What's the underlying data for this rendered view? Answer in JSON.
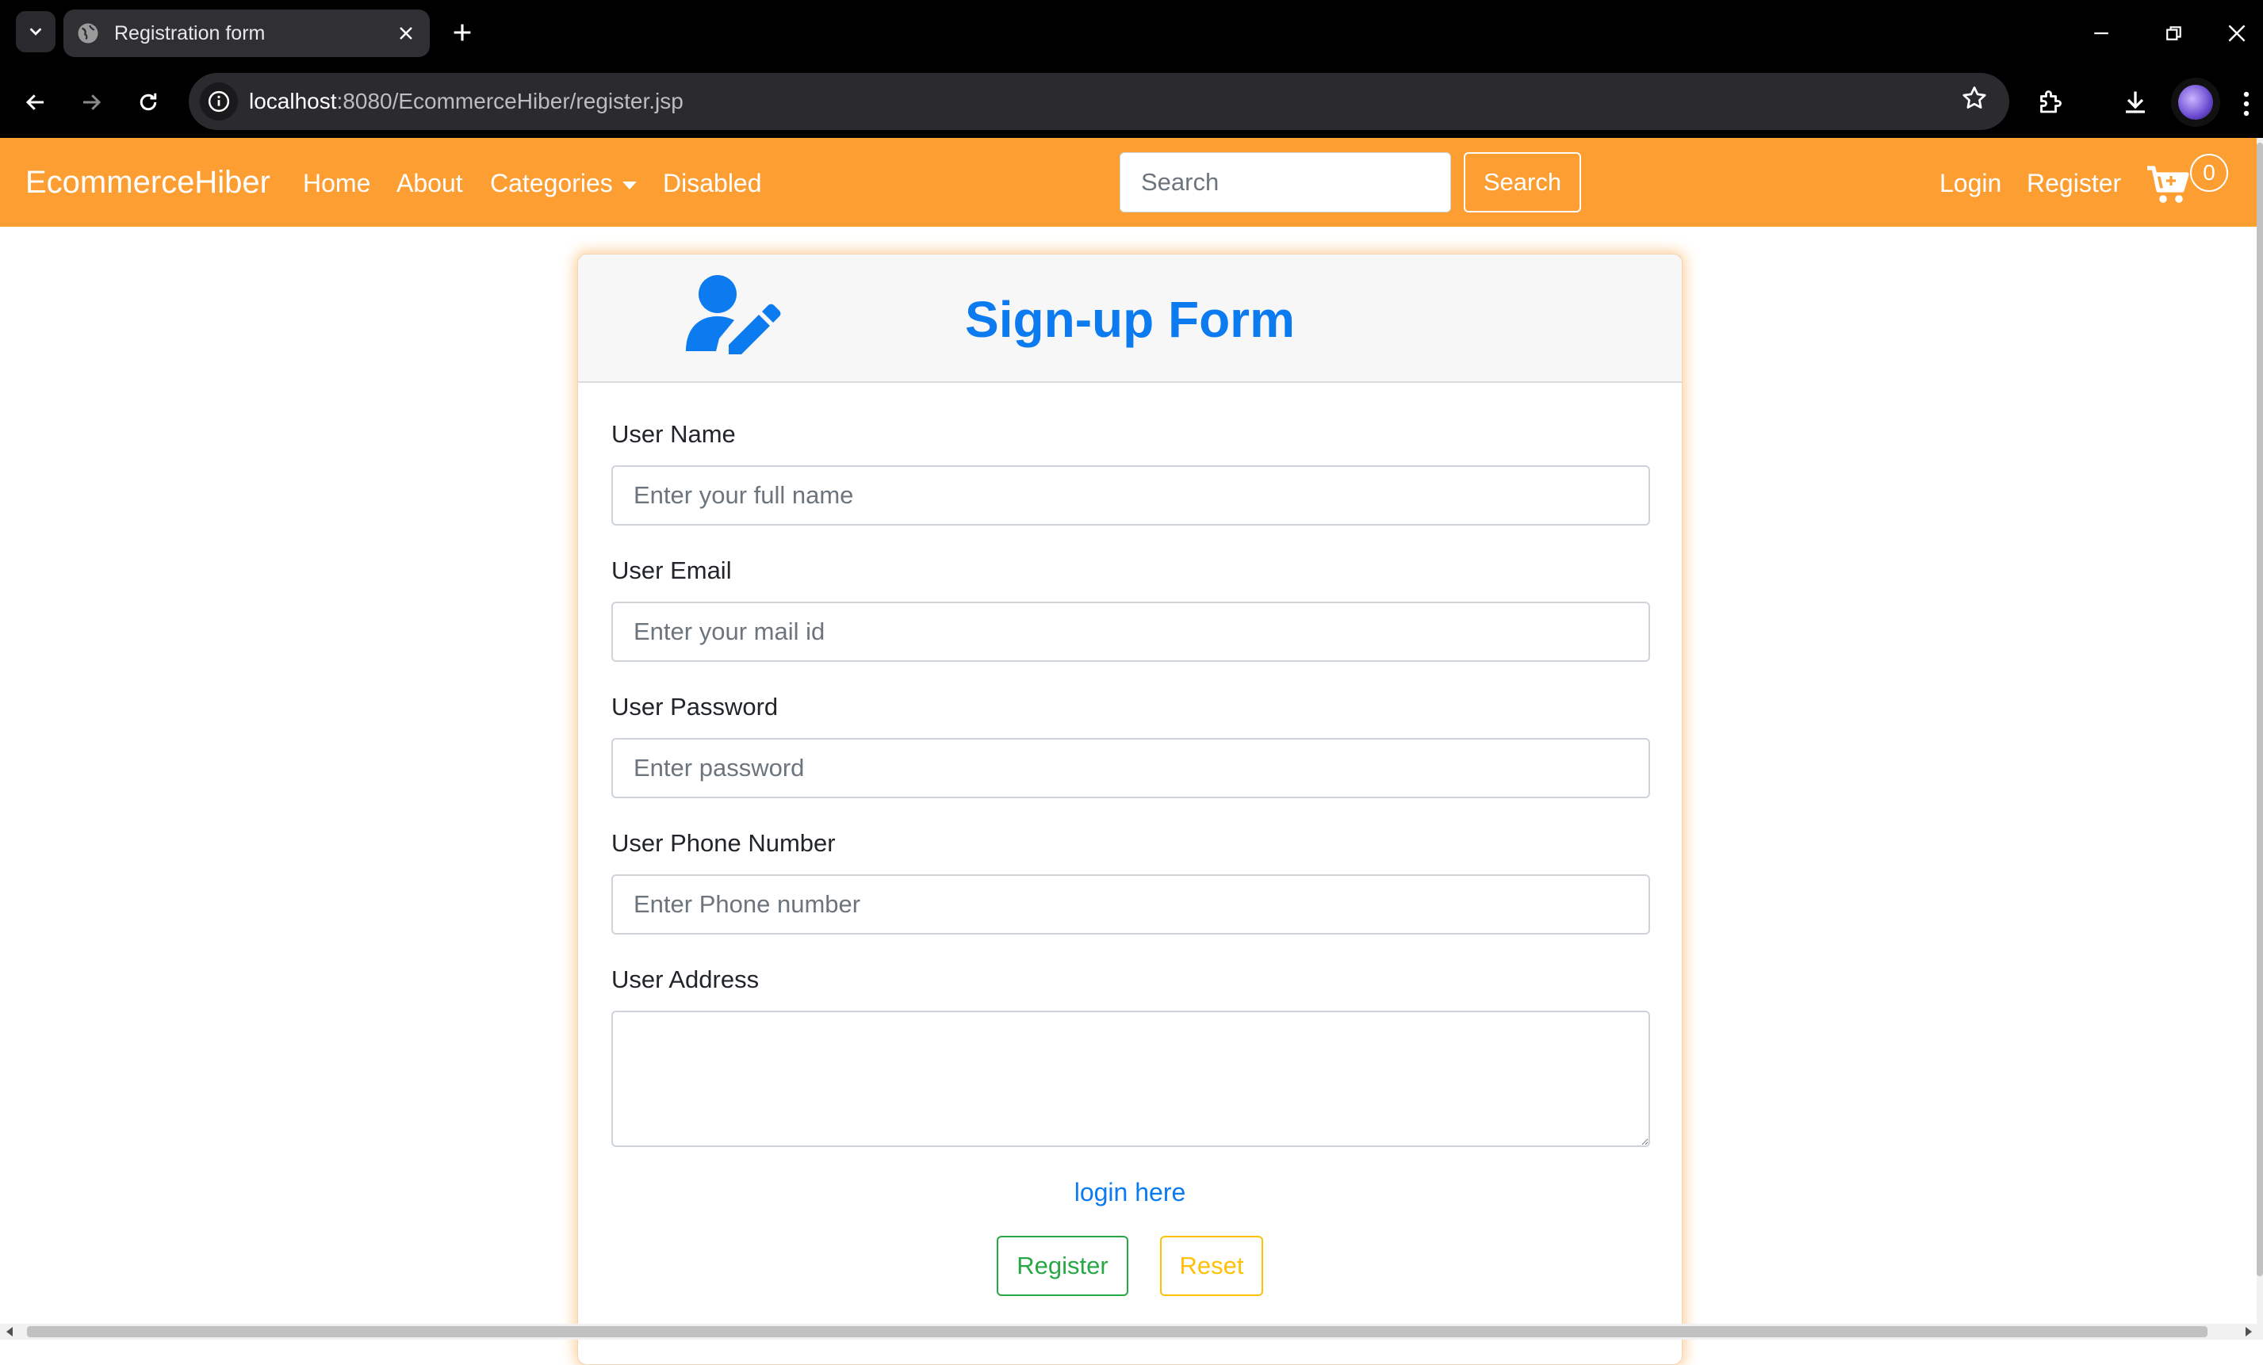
{
  "browser": {
    "tab_title": "Registration form",
    "url_host": "localhost",
    "url_rest": ":8080/EcommerceHiber/register.jsp"
  },
  "navbar": {
    "brand": "EcommerceHiber",
    "links": [
      "Home",
      "About",
      "Categories",
      "Disabled"
    ],
    "search_placeholder": "Search",
    "search_button": "Search",
    "login": "Login",
    "register": "Register",
    "cart_count": "0"
  },
  "form": {
    "title": "Sign-up Form",
    "fields": [
      {
        "label": "User Name",
        "placeholder": "Enter your full name"
      },
      {
        "label": "User Email",
        "placeholder": "Enter your mail id"
      },
      {
        "label": "User Password",
        "placeholder": "Enter password"
      },
      {
        "label": "User Phone Number",
        "placeholder": "Enter Phone number"
      },
      {
        "label": "User Address",
        "placeholder": ""
      }
    ],
    "login_link": "login here",
    "register_button": "Register",
    "reset_button": "Reset"
  },
  "colors": {
    "navbar": "#fd9e33",
    "title_blue": "#0d7bf0",
    "register_green": "#28a745",
    "reset_yellow": "#ffc107"
  }
}
